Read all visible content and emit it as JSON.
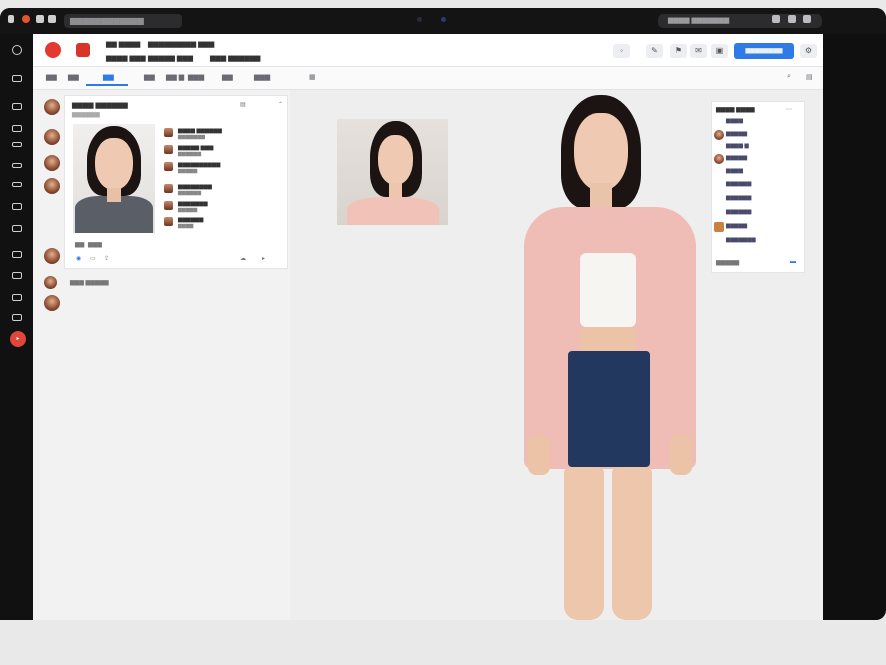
{
  "browser": {
    "tab_title": "▆▆▆▆▆▆▆▆▆▆▆▆",
    "search_text": "▆▆▆▆ ▆▆▆▆▆▆▆"
  },
  "header": {
    "line1_a": "▆▆ ▆▆▆▆",
    "line1_b": "▆▆▆▆▆▆",
    "line1_c": "▆▆▆ ▆▆▆",
    "line2_a": "▆▆▆▆ ▆▆▆",
    "line2_b": "▆▆▆▆▆ ▆▆▆",
    "line2_c": "▆▆▆ ▆▆▆▆▆▆",
    "primary_button": "▆▆▆▆▆▆▆▆"
  },
  "tabs": [
    "▆▆",
    "▆▆",
    "▆▆",
    "▆▆",
    "▆▆ ▆",
    "▆▆▆",
    "▆▆",
    "▆▆▆"
  ],
  "left_list": {
    "item_label": "▆▆▆ ▆▆▆▆▆"
  },
  "profile_card": {
    "title": "▆▆▆▆ ▆▆▆▆▆▆",
    "rows": [
      {
        "main": "▆▆▆▆ ▆▆▆▆▆▆",
        "sub": "▆▆▆▆▆▆▆"
      },
      {
        "main": "▆▆▆▆▆ ▆▆▆",
        "sub": "▆▆▆▆▆▆"
      },
      {
        "main": "▆▆▆▆▆▆▆▆▆▆",
        "sub": "▆▆▆▆▆"
      },
      {
        "main": "▆▆▆▆▆▆▆▆",
        "sub": "▆▆▆▆▆▆"
      },
      {
        "main": "▆▆▆▆▆▆▆",
        "sub": "▆▆▆▆▆"
      },
      {
        "main": "▆▆▆▆▆▆",
        "sub": "▆▆▆▆"
      }
    ],
    "footer_a": "▆▆",
    "footer_b": "▆▆▆"
  },
  "right_panel": {
    "title": "▆▆▆▆ ▆▆▆▆",
    "rows": [
      "▆▆▆▆",
      "▆▆▆▆▆",
      "▆▆▆▆ ▆",
      "▆▆▆▆▆",
      "▆▆▆▆",
      "▆▆▆▆▆▆",
      "▆▆▆▆▆▆",
      "▆▆▆▆▆▆",
      "▆▆▆▆▆",
      "▆▆▆▆▆▆▆"
    ],
    "footer": "▆▆▆▆▆"
  }
}
